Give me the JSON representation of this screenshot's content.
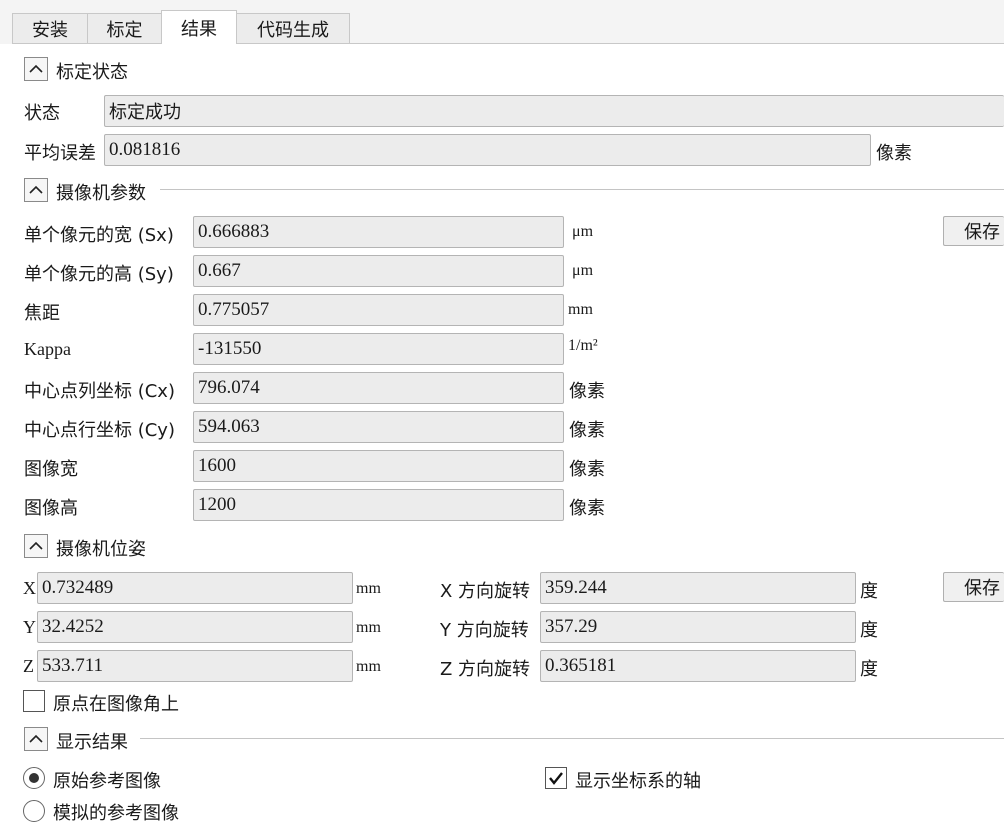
{
  "tabs": [
    "安装",
    "标定",
    "结果",
    "代码生成"
  ],
  "sections": {
    "status": "标定状态",
    "camera_params": "摄像机参数",
    "camera_pose": "摄像机位姿",
    "display": "显示结果"
  },
  "status": {
    "state_label": "状态",
    "state_value": "标定成功",
    "error_label": "平均误差",
    "error_value": "0.081816",
    "error_unit": "像素"
  },
  "camera_params": [
    {
      "label": "单个像元的宽 (Sx)",
      "value": "0.666883",
      "unit": "μm"
    },
    {
      "label": "单个像元的高 (Sy)",
      "value": "0.667",
      "unit": "μm"
    },
    {
      "label": "焦距",
      "value": "0.775057",
      "unit": "mm"
    },
    {
      "label": "Kappa",
      "value": "-131550",
      "unit": "1/m²"
    },
    {
      "label": "中心点列坐标 (Cx)",
      "value": "796.074",
      "unit": "像素"
    },
    {
      "label": "中心点行坐标 (Cy)",
      "value": "594.063",
      "unit": "像素"
    },
    {
      "label": "图像宽",
      "value": "1600",
      "unit": "像素"
    },
    {
      "label": "图像高",
      "value": "1200",
      "unit": "像素"
    }
  ],
  "save_label": "保存",
  "pose": {
    "translation": [
      {
        "label": "X",
        "value": "0.732489",
        "unit": "mm"
      },
      {
        "label": "Y",
        "value": "32.4252",
        "unit": "mm"
      },
      {
        "label": "Z",
        "value": "533.711",
        "unit": "mm"
      }
    ],
    "rotation": [
      {
        "label": "X 方向旋转",
        "value": "359.244",
        "unit": "度"
      },
      {
        "label": "Y 方向旋转",
        "value": "357.29",
        "unit": "度"
      },
      {
        "label": "Z 方向旋转",
        "value": "0.365181",
        "unit": "度"
      }
    ],
    "origin_corner_label": "原点在图像角上",
    "origin_corner_checked": false
  },
  "display": {
    "radio_original": "原始参考图像",
    "radio_simulated": "模拟的参考图像",
    "selected": "原始参考图像",
    "show_axes_label": "显示坐标系的轴",
    "show_axes_checked": true
  }
}
